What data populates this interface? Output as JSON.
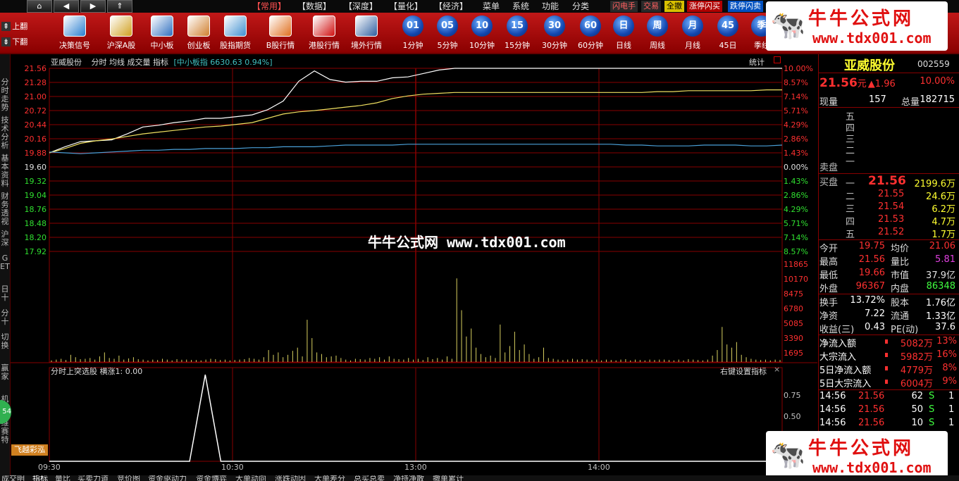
{
  "top_menu": {
    "items": [
      "【常用】",
      "【数据】",
      "【深度】",
      "【量化】",
      "【经济】",
      "菜单",
      "系统",
      "功能",
      "分类"
    ],
    "active_index": 0,
    "right_buttons": [
      {
        "label": "闪电手",
        "bg": "#2a2a2a",
        "color": "#ff6060"
      },
      {
        "label": "交易",
        "bg": "#2a2a2a",
        "color": "#ff6060"
      },
      {
        "label": "全撤",
        "bg": "#d8c000",
        "color": "#000000"
      },
      {
        "label": "涨停闪买",
        "bg": "#b00000",
        "color": "#ffffff"
      },
      {
        "label": "跌停闪卖",
        "bg": "#0050c0",
        "color": "#ffffff"
      }
    ]
  },
  "flip": {
    "up": "上翻",
    "down": "下翻"
  },
  "toolbar": [
    {
      "label": "决策信号",
      "icon": "monitor-icon",
      "color": "#2a7fd0"
    },
    {
      "label": "沪深A股",
      "icon": "a-shares-icon",
      "color": "#d0a020"
    },
    {
      "label": "中小板",
      "icon": "sme-board-icon",
      "color": "#3070c0"
    },
    {
      "label": "创业板",
      "icon": "growth-board-icon",
      "color": "#d08030"
    },
    {
      "label": "股指期货",
      "icon": "futures-icon",
      "color": "#4090d0"
    },
    {
      "label": "B股行情",
      "icon": "b-shares-icon",
      "color": "#e07020"
    },
    {
      "label": "港股行情",
      "icon": "hk-flower-icon",
      "color": "#d01010"
    },
    {
      "label": "境外行情",
      "icon": "globe-search-icon",
      "color": "#3060a0"
    }
  ],
  "periods": [
    "01",
    "05",
    "10",
    "15",
    "30",
    "60",
    "日",
    "周",
    "月",
    "45",
    "季"
  ],
  "period_labels": [
    "1分钟",
    "5分钟",
    "10分钟",
    "15分钟",
    "30分钟",
    "60分钟",
    "日线",
    "周线",
    "月线",
    "45日",
    "季线"
  ],
  "left_tabs": [
    "分时走势",
    "技术分析",
    "基本资料",
    "财务透视",
    "沪深",
    "GET",
    "日十",
    "分十",
    "切换",
    "赢家",
    "机10",
    "维赛特"
  ],
  "chart_header": {
    "name": "亚威股份",
    "tabs": "分时 均线 成交量 指标",
    "index_info": "[中小板指 6630.63 0.94%]",
    "stats_button": "统计"
  },
  "chart_data": [
    {
      "type": "line",
      "series": [
        {
          "color": "#ffffff",
          "values": [
            19.6,
            19.74,
            19.86,
            19.88,
            19.9,
            20.04,
            20.2,
            20.24,
            20.3,
            20.34,
            20.4,
            20.4,
            20.44,
            20.48,
            20.6,
            20.8,
            21.26,
            21.5,
            21.3,
            21.24,
            21.26,
            21.26,
            21.34,
            21.36,
            21.44,
            21.52,
            21.56,
            21.56,
            21.56,
            21.56,
            21.56,
            21.56,
            21.56,
            21.56,
            21.56,
            21.56,
            21.56,
            21.56,
            21.56,
            21.56,
            21.56,
            21.56,
            21.56,
            21.56,
            21.56,
            21.56,
            21.56,
            21.56
          ]
        },
        {
          "color": "#f0e060",
          "values": [
            19.6,
            19.7,
            19.82,
            19.88,
            19.92,
            19.98,
            20.04,
            20.08,
            20.12,
            20.16,
            20.2,
            20.22,
            20.26,
            20.3,
            20.4,
            20.5,
            20.55,
            20.58,
            20.62,
            20.66,
            20.7,
            20.76,
            20.86,
            20.92,
            20.96,
            20.98,
            21.0,
            21.0,
            21.0,
            21.0,
            21.0,
            21.0,
            21.0,
            21.0,
            21.0,
            21.0,
            21.0,
            21.0,
            21.0,
            21.02,
            21.02,
            21.04,
            21.04,
            21.04,
            21.04,
            21.04,
            21.06,
            21.06
          ]
        },
        {
          "color": "#4aa0d8",
          "values": [
            19.62,
            19.6,
            19.58,
            19.6,
            19.62,
            19.64,
            19.66,
            19.66,
            19.68,
            19.68,
            19.7,
            19.7,
            19.7,
            19.72,
            19.72,
            19.74,
            19.74,
            19.74,
            19.76,
            19.78,
            19.78,
            19.78,
            19.78,
            19.8,
            19.8,
            19.8,
            19.8,
            19.8,
            19.8,
            19.8,
            19.8,
            19.8,
            19.8,
            19.8,
            19.8,
            19.8,
            19.8,
            19.78,
            19.78,
            19.76,
            19.76,
            19.76,
            19.78,
            19.78,
            19.78,
            19.76,
            19.76,
            19.78
          ]
        }
      ],
      "ylim": [
        17.64,
        21.56
      ],
      "price_ticks": [
        "21.56",
        "21.28",
        "21.00",
        "20.72",
        "20.44",
        "20.16",
        "19.88",
        "19.60",
        "19.32",
        "19.04",
        "18.76",
        "18.48",
        "18.20",
        "17.92"
      ],
      "pct_ticks": [
        "10.00%",
        "8.57%",
        "7.14%",
        "5.71%",
        "4.29%",
        "2.86%",
        "1.43%",
        "0.00%",
        "1.43%",
        "2.86%",
        "4.29%",
        "5.71%",
        "7.14%",
        "8.57%"
      ]
    },
    {
      "type": "bar",
      "ylim": [
        0,
        13000
      ],
      "vol_ticks": [
        "11865",
        "10170",
        "8475",
        "6780",
        "5085",
        "3390",
        "1695"
      ],
      "values": [
        200,
        300,
        400,
        250,
        900,
        600,
        350,
        400,
        500,
        300,
        700,
        1200,
        500,
        400,
        800,
        300,
        450,
        600,
        350,
        300,
        200,
        300,
        250,
        400,
        300,
        200,
        350,
        280,
        300,
        260,
        250,
        200,
        300,
        400,
        350,
        250,
        300,
        200,
        250,
        300,
        350,
        500,
        400,
        300,
        600,
        1500,
        900,
        1200,
        600,
        900,
        1400,
        1800,
        700,
        5300,
        3000,
        1200,
        1000,
        600,
        700,
        800,
        500,
        300,
        200,
        400,
        350,
        300,
        500,
        400,
        600,
        300,
        700,
        400,
        350,
        300,
        500,
        300,
        400,
        250,
        600,
        350,
        500,
        300,
        700,
        400,
        10500,
        6500,
        3200,
        4200,
        1800,
        1000,
        600,
        800,
        500,
        4700,
        1200,
        2000,
        3800,
        1500,
        2200,
        1000,
        400,
        600,
        1800,
        500,
        400,
        300,
        250,
        300,
        400,
        300,
        350,
        300,
        250,
        300,
        200,
        300,
        250,
        200,
        300,
        350,
        200,
        300,
        250,
        200,
        300,
        250,
        300,
        300,
        250,
        200,
        300,
        200,
        350,
        300,
        250,
        200,
        300,
        800,
        1500,
        4400,
        2200,
        1800,
        2500,
        900,
        600,
        400,
        300,
        250,
        300,
        200,
        300,
        250
      ]
    },
    {
      "type": "line",
      "ylim": [
        0,
        1
      ],
      "ticks": [
        "0.75",
        "0.50"
      ],
      "values": [
        0,
        0,
        0,
        0,
        0,
        0,
        0,
        0,
        0,
        0,
        1,
        0,
        0,
        0,
        0,
        0,
        0,
        0,
        0,
        0,
        0,
        0,
        0,
        0,
        0,
        0,
        0,
        0,
        0,
        0,
        0,
        0,
        0,
        0,
        0,
        0,
        0,
        0,
        0,
        0,
        0,
        0,
        0,
        0,
        0,
        0,
        0,
        0
      ]
    }
  ],
  "sub_indicator": {
    "title": "分时上突选股  横涨1: 0.00",
    "settings": "右键设置指标",
    "badge": "飞越彩泓"
  },
  "x_axis": [
    "09:30",
    "10:30",
    "13:00",
    "14:00"
  ],
  "watermark_center": "牛牛公式网 www.tdx001.com",
  "watermark_corner": {
    "title": "牛牛公式网",
    "url": "www.tdx001.com"
  },
  "quote": {
    "name": "亚威股份",
    "code": "002559",
    "price": "21.56",
    "unit": "元",
    "change": "▲1.96",
    "pct": "10.00%",
    "cur_vol_label": "现量",
    "cur_vol": "157",
    "total_vol_label": "总量",
    "total_vol": "182715",
    "sell_labels": [
      "五",
      "四",
      "三",
      "二",
      "一"
    ],
    "sell_side_label": "卖盘",
    "buy_side_label": "买盘",
    "buy": [
      {
        "lvl": "一",
        "price": "21.56",
        "vol": "2199.6万"
      },
      {
        "lvl": "二",
        "price": "21.55",
        "vol": "24.6万"
      },
      {
        "lvl": "三",
        "price": "21.54",
        "vol": "6.2万"
      },
      {
        "lvl": "四",
        "price": "21.53",
        "vol": "4.7万"
      },
      {
        "lvl": "五",
        "price": "21.52",
        "vol": "1.7万"
      }
    ],
    "stats": [
      {
        "l1": "今开",
        "v1": "19.75",
        "c1": "#ff3030",
        "l2": "均价",
        "v2": "21.06",
        "c2": "#ff3030"
      },
      {
        "l1": "最高",
        "v1": "21.56",
        "c1": "#ff3030",
        "l2": "量比",
        "v2": "5.81",
        "c2": "#e040e0"
      },
      {
        "l1": "最低",
        "v1": "19.66",
        "c1": "#ff3030",
        "l2": "市值",
        "v2": "37.9亿",
        "c2": "#e0e0e0"
      },
      {
        "l1": "外盘",
        "v1": "96367",
        "c1": "#ff3030",
        "l2": "内盘",
        "v2": "86348",
        "c2": "#40ff40"
      }
    ],
    "stats2": [
      {
        "l1": "换手",
        "v1": "13.72%",
        "l2": "股本",
        "v2": "1.76亿"
      },
      {
        "l1": "净资",
        "v1": "7.22",
        "l2": "流通",
        "v2": "1.33亿"
      },
      {
        "l1": "收益(三)",
        "v1": "0.43",
        "l2": "PE(动)",
        "v2": "37.6"
      }
    ],
    "flows": [
      {
        "label": "净流入额",
        "v": "5082万",
        "p": "13%"
      },
      {
        "label": "大宗流入",
        "v": "5982万",
        "p": "16%"
      },
      {
        "label": "5日净流入额",
        "v": "4779万",
        "p": "8%"
      },
      {
        "label": "5日大宗流入",
        "v": "6004万",
        "p": "9%"
      }
    ],
    "ticks": [
      {
        "t": "14:56",
        "p": "21.56",
        "v": "62",
        "s": "S",
        "n": "1"
      },
      {
        "t": "14:56",
        "p": "21.56",
        "v": "50",
        "s": "S",
        "n": "1"
      },
      {
        "t": "14:56",
        "p": "21.56",
        "v": "10",
        "s": "S",
        "n": "1"
      }
    ]
  },
  "bottom_tabs": [
    "成交明",
    "指标",
    "量比",
    "买卖力道",
    "竞价图",
    "资金驱动力",
    "资金博弈",
    "大单动向",
    "涨跌动因",
    "大单差分",
    "总买总卖",
    "净持净散",
    "撤单累计"
  ]
}
